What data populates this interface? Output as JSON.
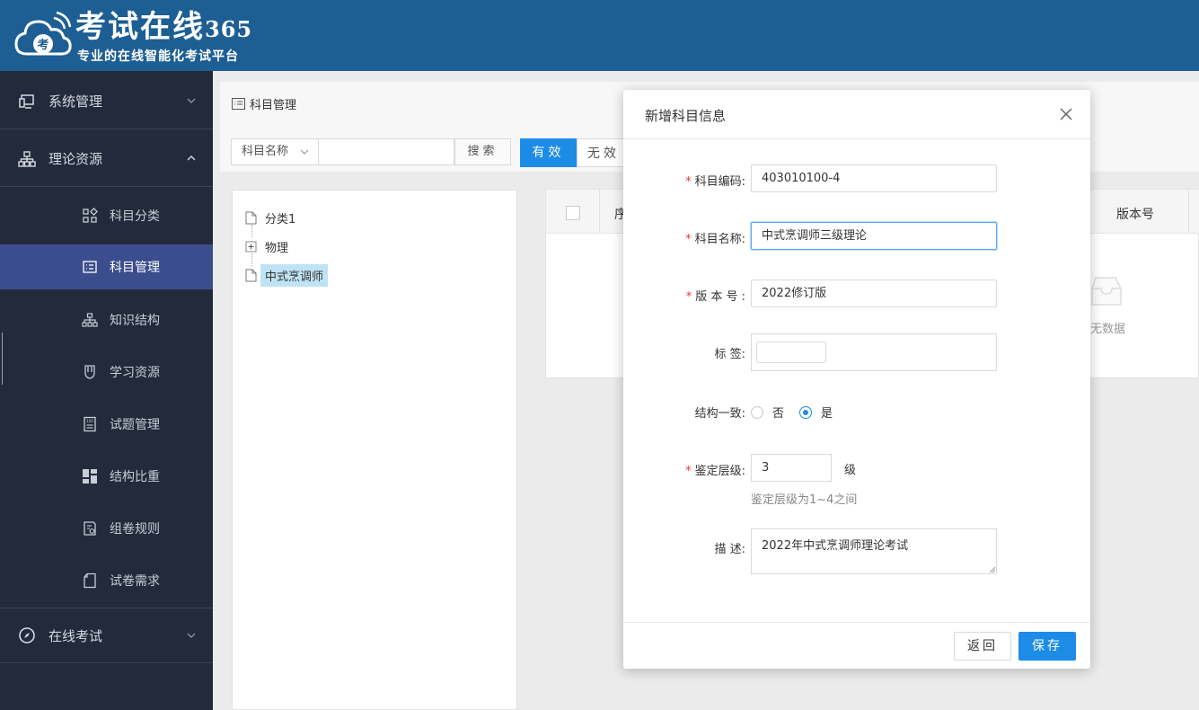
{
  "header": {
    "logo_badge": "考",
    "title_main": "考试在线",
    "title_num": "365",
    "subtitle": "专业的在线智能化考试平台"
  },
  "sidebar": {
    "groups": [
      {
        "label": "系统管理",
        "icon": "monitor-icon"
      },
      {
        "label": "理论资源",
        "icon": "sitemap-icon"
      },
      {
        "label": "在线考试",
        "icon": "compass-icon"
      }
    ],
    "items": [
      {
        "label": "科目分类",
        "icon": "grid-icon"
      },
      {
        "label": "科目管理",
        "icon": "list-icon",
        "active": true
      },
      {
        "label": "知识结构",
        "icon": "sitemap-icon"
      },
      {
        "label": "学习资源",
        "icon": "shield-icon"
      },
      {
        "label": "试题管理",
        "icon": "exam-icon"
      },
      {
        "label": "结构比重",
        "icon": "dashboard-icon"
      },
      {
        "label": "组卷规则",
        "icon": "rule-icon"
      },
      {
        "label": "试卷需求",
        "icon": "file-icon"
      }
    ]
  },
  "main": {
    "breadcrumb": "科目管理",
    "search_field": "科目名称",
    "search_button": "搜索",
    "tab_valid": "有效",
    "tab_invalid": "无效",
    "tree": [
      {
        "label": "分类1",
        "icon": "file-icon"
      },
      {
        "label": "物理",
        "icon": "expand-icon"
      },
      {
        "label": "中式烹调师",
        "icon": "file-icon",
        "selected": true
      }
    ],
    "table": {
      "col_seq": "序",
      "col_version": "版本号",
      "empty_text": "无数据"
    }
  },
  "modal": {
    "title": "新增科目信息",
    "code_label": "科目编码:",
    "code_value": "403010100-4",
    "name_label": "科目名称:",
    "name_value": "中式烹调师三级理论",
    "version_label": "版 本 号 :",
    "version_value": "2022修订版",
    "tag_label": "标      签:",
    "struct_label": "结构一致:",
    "struct_options": [
      "否",
      "是"
    ],
    "struct_selected": "是",
    "level_label": "鉴定层级:",
    "level_value": "3",
    "level_unit": "级",
    "level_hint": "鉴定层级为1~4之间",
    "desc_label": "描      述:",
    "desc_value": "2022年中式烹调师理论考试",
    "back_button": "返回",
    "save_button": "保存"
  },
  "colors": {
    "header_bg": "#1d5e95",
    "sidebar_bg": "#232a3b",
    "active_item": "#3b4d8d",
    "primary": "#1d8ce6",
    "required": "#e33333"
  }
}
